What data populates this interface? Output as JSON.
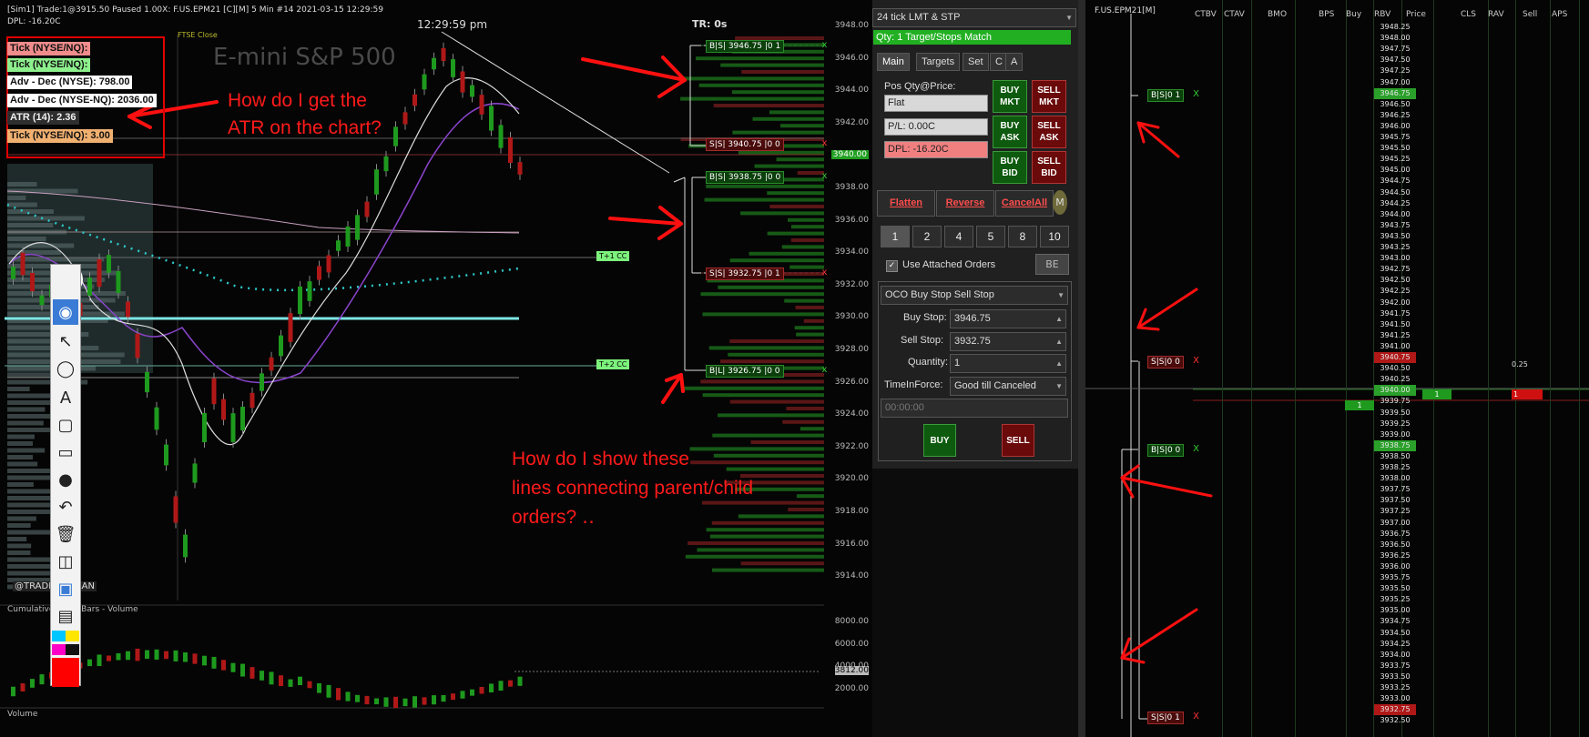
{
  "chart": {
    "status_line_1": "[Sim1] Trade:1@3915.50  Paused 1.00X: F.US.EPM21 [C][M]  5 Min  #14 2021-03-15 12:29:59",
    "status_line_2": "DPL: -16.20C",
    "clock": "12:29:59 pm",
    "instrument_title": "E-mini S&P 500",
    "ftse_label": "FTSE Close",
    "tr_label": "TR: 0s",
    "author_label": "@TRADERS_PLAN",
    "lower_panel_label": "Cumulative Delta Bars - Volume",
    "volume_panel_label": "Volume",
    "last_price_tag": "3940.00",
    "cd_tag": "3812.00",
    "y_ticks": [
      "3948.00",
      "3946.00",
      "3944.00",
      "3942.00",
      "3940.00",
      "3938.00",
      "3936.00",
      "3934.00",
      "3932.00",
      "3930.00",
      "3928.00",
      "3926.00",
      "3924.00",
      "3922.00",
      "3920.00",
      "3918.00",
      "3916.00",
      "3914.00"
    ],
    "lower_y_ticks": [
      "8000.00",
      "6000.00",
      "4000.00",
      "2000.00"
    ],
    "level_tags": [
      "T+1 CC",
      "T+2 CC"
    ]
  },
  "indicators": [
    {
      "label": "Tick (NYSE/NQ):",
      "bg": "#f08c8c"
    },
    {
      "label": "Tick (NYSE/NQ):",
      "bg": "#8df08d"
    },
    {
      "label": "Adv - Dec (NYSE): 798.00",
      "bg": "#ffffff"
    },
    {
      "label": "Adv - Dec (NYSE-NQ): 2036.00",
      "bg": "#ffffff"
    },
    {
      "label": "ATR (14): 2.36",
      "bg": "#2e2e2e"
    },
    {
      "label": "Tick (NYSE/NQ):  3.00",
      "bg": "#f0b070"
    }
  ],
  "callouts": {
    "atr_question_1": "How do I get the",
    "atr_question_2": "ATR on the chart?",
    "lines_question_1": "How do I show these",
    "lines_question_2": "lines connecting parent/child",
    "lines_question_3": "orders? ‥"
  },
  "orders": [
    {
      "label": "B|S| 3946.75 |0 1",
      "side": "buy"
    },
    {
      "label": "S|S| 3940.75 |0 0",
      "side": "sell"
    },
    {
      "label": "B|S| 3938.75 |0 0",
      "side": "buy"
    },
    {
      "label": "S|S| 3932.75 |0 1",
      "side": "sell"
    },
    {
      "label": "B|L| 3926.75 |0 0",
      "side": "buy"
    }
  ],
  "panel": {
    "atm_strategy": "24 tick LMT & STP",
    "qty_label": "Qty: 1 Target/Stops Match",
    "tabs": [
      "Main",
      "Targets",
      "Set",
      "C",
      "A"
    ],
    "pos_label": "Pos Qty@Price:",
    "pos_value": "Flat",
    "pl_value": "P/L: 0.00C",
    "dpl_value": "DPL: -16.20C",
    "buy_mkt": "BUY MKT",
    "sell_mkt": "SELL MKT",
    "buy_ask": "BUY ASK",
    "sell_ask": "SELL ASK",
    "buy_bid": "BUY BID",
    "sell_bid": "SELL BID",
    "flatten": "Flatten",
    "reverse": "Reverse",
    "cancel_all": "CancelAll",
    "m_label": "M",
    "quantities": [
      "1",
      "2",
      "4",
      "5",
      "8",
      "10"
    ],
    "use_attached": "Use Attached Orders",
    "be_label": "BE",
    "oco_type": "OCO Buy Stop Sell Stop",
    "buy_stop_label": "Buy Stop:",
    "buy_stop_value": "3946.75",
    "sell_stop_label": "Sell Stop:",
    "sell_stop_value": "3932.75",
    "quantity_label": "Quantity:",
    "quantity_value": "1",
    "tif_label": "TimeInForce:",
    "tif_value": "Good till Canceled",
    "time_value": "00:00:00",
    "buy": "BUY",
    "sell": "SELL"
  },
  "ladder": {
    "symbol": "F.US.EPM21[M]",
    "columns": [
      "CTBV",
      "CTAV",
      "BMO",
      "BPS",
      "Buy",
      "RBV",
      "Price",
      "CLS",
      "RAV",
      "Sell",
      "APS"
    ],
    "prices": [
      "3948.25",
      "3948.00",
      "3947.75",
      "3947.50",
      "3947.25",
      "3947.00",
      "3946.75",
      "3946.50",
      "3946.25",
      "3946.00",
      "3945.75",
      "3945.50",
      "3945.25",
      "3945.00",
      "3944.75",
      "3944.50",
      "3944.25",
      "3944.00",
      "3943.75",
      "3943.50",
      "3943.25",
      "3943.00",
      "3942.75",
      "3942.50",
      "3942.25",
      "3942.00",
      "3941.75",
      "3941.50",
      "3941.25",
      "3941.00",
      "3940.75",
      "3940.50",
      "3940.25",
      "3940.00",
      "3939.75",
      "3939.50",
      "3939.25",
      "3939.00",
      "3938.75",
      "3938.50",
      "3938.25",
      "3938.00",
      "3937.75",
      "3937.50",
      "3937.25",
      "3937.00",
      "3936.75",
      "3936.50",
      "3936.25",
      "3936.00",
      "3935.75",
      "3935.50",
      "3935.25",
      "3935.00",
      "3934.75",
      "3934.50",
      "3934.25",
      "3934.00",
      "3933.75",
      "3933.50",
      "3933.25",
      "3933.00",
      "3932.75",
      "3932.50"
    ],
    "order_flags": [
      "B|S|0 1",
      "S|S|0 0",
      "B|S|0 0",
      "S|S|0 1"
    ],
    "sell_value": "0.25",
    "cls_value": "1",
    "sell_cell_value": "1",
    "buy_cell_value": "1"
  }
}
